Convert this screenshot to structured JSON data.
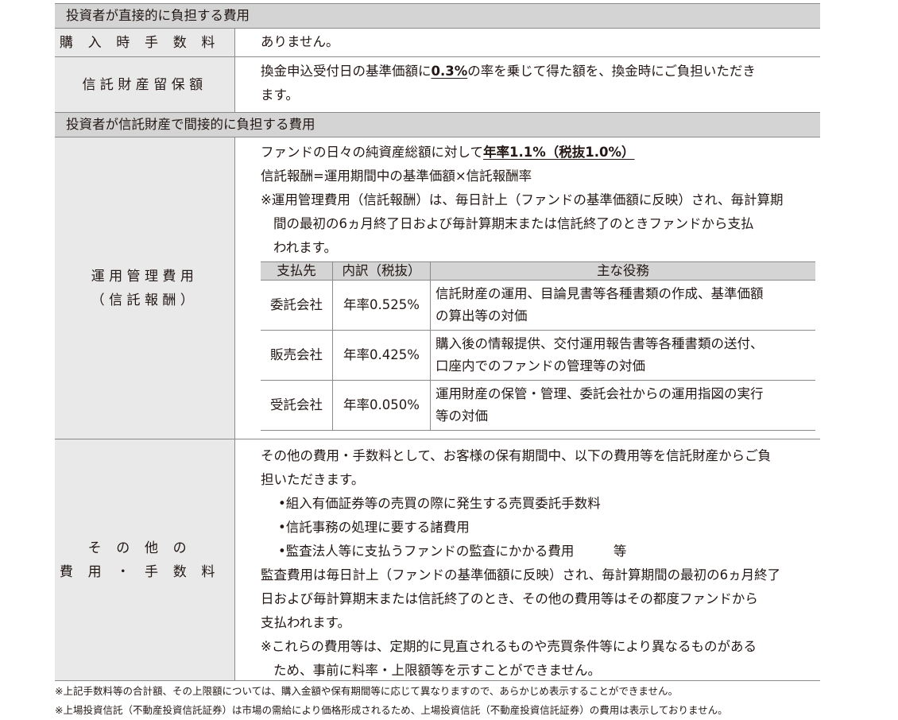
{
  "section1": {
    "title": "投資者が直接的に負担する費用",
    "rows": [
      {
        "label": "購入時手数料",
        "lines": [
          "ありません。"
        ]
      },
      {
        "label": "信託財産留保額",
        "line1_pre": "換金申込受付日の基準価額に",
        "line1_u": "0.3%",
        "line1_post": "の率を乗じて得た額を、換金時にご負担いただき",
        "line2": "ます。"
      }
    ]
  },
  "section2": {
    "title": "投資者が信託財産で間接的に負担する費用",
    "mgmt": {
      "label1": "運用管理費用",
      "label2": "（信託報酬）",
      "line1_pre": "ファンドの日々の純資産総額に対して",
      "line1_u": "年率1.1%（税抜1.0%）",
      "line2": "信託報酬=運用期間中の基準価額×信託報酬率",
      "note1": "※運用管理費用（信託報酬）は、毎日計上（ファンドの基準価額に反映）され、毎計算期",
      "note2": "間の最初の6ヵ月終了日および毎計算期末または信託終了のときファンドから支払",
      "note3": "われます。",
      "table": {
        "headers": [
          "支払先",
          "内訳（税抜）",
          "主な役務"
        ],
        "rows": [
          {
            "payee": "委託会社",
            "rate": "年率0.525%",
            "d1": "信託財産の運用、目論見書等各種書類の作成、基準価額",
            "d2": "の算出等の対価"
          },
          {
            "payee": "販売会社",
            "rate": "年率0.425%",
            "d1": "購入後の情報提供、交付運用報告書等各種書類の送付、",
            "d2": "口座内でのファンドの管理等の対価"
          },
          {
            "payee": "受託会社",
            "rate": "年率0.050%",
            "d1": "運用財産の保管・管理、委託会社からの運用指図の実行",
            "d2": "等の対価"
          }
        ]
      }
    },
    "other": {
      "label1": "その他の",
      "label2": "費用・手数料",
      "lines": [
        "その他の費用・手数料として、お客様の保有期間中、以下の費用等を信託財産からご負",
        "担いただきます。"
      ],
      "bullets": [
        "•組入有価証券等の売買の際に発生する売買委託手数料",
        "•信託事務の処理に要する諸費用",
        "•監査法人等に支払うファンドの監査にかかる費用　　　等"
      ],
      "lines2": [
        "監査費用は毎日計上（ファンドの基準価額に反映）され、毎計算期間の最初の6ヵ月終了",
        "日および毎計算期末または信託終了のとき、その他の費用等はその都度ファンドから",
        "支払われます。"
      ],
      "note1": "※これらの費用等は、定期的に見直されるものや売買条件等により異なるものがある",
      "note2": "ため、事前に料率・上限額等を示すことができません。"
    }
  },
  "footnotes": [
    "※上記手数料等の合計額、その上限額については、購入金額や保有期間等に応じて異なりますので、あらかじめ表示することができません。",
    "※上場投資信託（不動産投資信託証券）は市場の需給により価格形成されるため、上場投資信託（不動産投資信託証券）の費用は表示しておりません。"
  ]
}
